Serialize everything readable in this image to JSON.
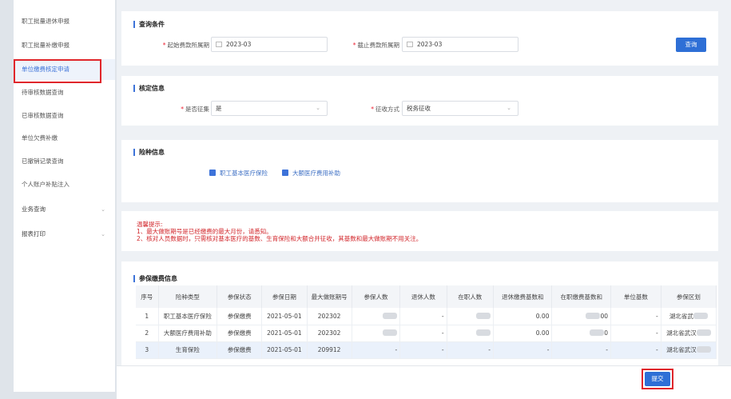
{
  "sidebar": {
    "items": [
      {
        "label": "职工批量退休申报"
      },
      {
        "label": "职工批量补缴申报"
      },
      {
        "label": "单位缴费核定申请"
      },
      {
        "label": "待审核数据查询"
      },
      {
        "label": "已审核数据查询"
      },
      {
        "label": "单位欠费补缴"
      },
      {
        "label": "已撤销记录查询"
      },
      {
        "label": "个人账户补贴注入"
      }
    ],
    "groups": [
      {
        "label": "业务查询"
      },
      {
        "label": "报表打印"
      }
    ]
  },
  "query": {
    "title": "查询条件",
    "start_label": "起始费款所属期",
    "start_value": "2023-03",
    "end_label": "截止费款所属期",
    "end_value": "2023-03",
    "button": "查询"
  },
  "approval": {
    "title": "核定信息",
    "collect_label": "是否征集",
    "collect_value": "是",
    "method_label": "征收方式",
    "method_value": "税务征收"
  },
  "insurance": {
    "title": "险种信息",
    "options": [
      {
        "label": "职工基本医疗保险",
        "checked": true
      },
      {
        "label": "大额医疗费用补助",
        "checked": true
      }
    ]
  },
  "tips": {
    "line1": "温馨提示:",
    "line2": "1、最大做账期号是已经缴费的最大月份，请悉知。",
    "line3": "2、核对人员数据时，只需核对基本医疗的基数、生育保险和大额合并征收，其基数和最大做账期不用关注。"
  },
  "payment": {
    "title": "参保缴费信息",
    "headers": [
      "序号",
      "险种类型",
      "参保状态",
      "参保日期",
      "最大做账期号",
      "参保人数",
      "退休人数",
      "在职人数",
      "退休缴费基数和",
      "在职缴费基数和",
      "单位基数",
      "参保区划"
    ],
    "rows": [
      [
        "1",
        "职工基本医疗保险",
        "参保缴费",
        "2021-05-01",
        "202302",
        "",
        "-",
        "",
        "0.00",
        "00",
        "-",
        "湖北省武"
      ],
      [
        "2",
        "大额医疗费用补助",
        "参保缴费",
        "2021-05-01",
        "202302",
        "",
        "-",
        "",
        "0.00",
        "0",
        "-",
        "湖北省武汉"
      ],
      [
        "3",
        "生育保险",
        "参保缴费",
        "2021-05-01",
        "209912",
        "-",
        "-",
        "-",
        "-",
        "-",
        "-",
        "湖北省武汉"
      ]
    ]
  },
  "footer": {
    "submit": "提交"
  },
  "colors": {
    "accent": "#2e6fd6",
    "highlight_box": "#e0262b",
    "tip_text": "#d2262b"
  }
}
